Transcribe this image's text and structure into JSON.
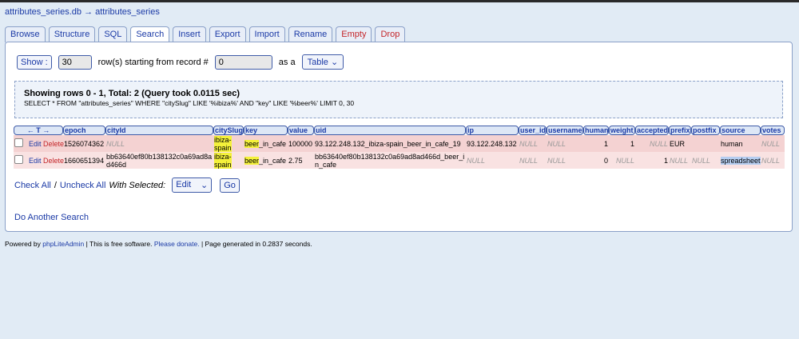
{
  "breadcrumb": {
    "db": "attributes_series.db",
    "arrow": "→",
    "table": "attributes_series"
  },
  "tabs": [
    "Browse",
    "Structure",
    "SQL",
    "Search",
    "Insert",
    "Export",
    "Import",
    "Rename",
    "Empty",
    "Drop"
  ],
  "active_tab": "Search",
  "controls": {
    "show_label": "Show :",
    "rows_value": "30",
    "rows_text": "row(s) starting from record #",
    "start_value": "0",
    "as_a": "as a",
    "view_select": "Table"
  },
  "query": {
    "title": "Showing rows 0 - 1, Total: 2 (Query took 0.0115 sec)",
    "sql": "SELECT * FROM \"attributes_series\" WHERE \"citySlug\" LIKE '%ibiza%' AND \"key\" LIKE '%beer%' LIMIT 0, 30"
  },
  "table": {
    "arrows": "← T →",
    "columns": [
      "epoch",
      "cityId",
      "citySlug",
      "key",
      "value",
      "uid",
      "ip",
      "user_id",
      "username",
      "human",
      "weight",
      "accepted",
      "prefix",
      "postfix",
      "source",
      "votes"
    ],
    "edit": "Edit",
    "delete": "Delete",
    "rows": [
      {
        "epoch": "1526074362",
        "cityId": "NULL",
        "citySlug": "ibiza-spain",
        "key_match": "beer",
        "key_rest": "_in_cafe",
        "value": "100000",
        "uid": "93.122.248.132_ibiza-spain_beer_in_cafe_19",
        "ip": "93.122.248.132",
        "user_id": "NULL",
        "username": "NULL",
        "human": "1",
        "weight": "1",
        "accepted": "NULL",
        "prefix": "EUR",
        "postfix": "",
        "source": "human",
        "votes": "NULL"
      },
      {
        "epoch": "1660651394",
        "cityId": "bb63640ef80b138132c0a69ad8ad466d",
        "citySlug": "ibiza-spain",
        "key_match": "beer",
        "key_rest": "_in_cafe",
        "value": "2.75",
        "uid": "bb63640ef80b138132c0a69ad8ad466d_beer_in_cafe",
        "ip": "NULL",
        "user_id": "NULL",
        "username": "NULL",
        "human": "0",
        "weight": "NULL",
        "accepted": "1",
        "prefix": "NULL",
        "postfix": "NULL",
        "source": "spreadsheet",
        "votes": "NULL"
      }
    ]
  },
  "actions": {
    "check_all": "Check All",
    "sep": "/",
    "uncheck_all": "Uncheck All",
    "with_selected": "With Selected:",
    "select": "Edit",
    "go": "Go"
  },
  "another_search": "Do Another Search",
  "footer": {
    "powered": "Powered by",
    "app": "phpLiteAdmin",
    "free": "| This is free software.",
    "donate": "Please donate.",
    "generated": "| Page generated in 0.2837 seconds."
  },
  "colors": {
    "link": "#1b3aa6",
    "danger": "#c4262a",
    "highlight": "#f4f13a"
  }
}
